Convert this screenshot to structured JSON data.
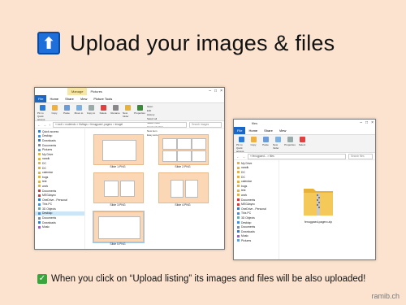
{
  "header": {
    "icon": "up-arrow-icon",
    "title": "Upload your images & files",
    "icon_glyph": "⬆"
  },
  "footer": {
    "text": "When you click on “Upload listing” its images and files will be also uploaded!",
    "check_glyph": "✓"
  },
  "brand": "ramib.ch",
  "left_window": {
    "context_tab": "Manage",
    "title": "Pictures",
    "menu": [
      "File",
      "Home",
      "Share",
      "View",
      "Picture Tools"
    ],
    "ribbon": [
      "Pin to Quick access",
      "Copy",
      "Paste",
      "Move to",
      "Copy to",
      "Delete",
      "Rename",
      "New folder",
      "Properties"
    ],
    "ribbon_small": [
      "Open",
      "Edit",
      "History",
      "Select all",
      "Select none",
      "Invert selection",
      "New item",
      "Easy access"
    ],
    "address": "« nodi > nodeindu > f4vlisgs > fenugpaed ,pagero > imagel",
    "search": "Search images",
    "nav": [
      {
        "label": "Quick access",
        "color": "#2b7bd8"
      },
      {
        "label": "Desktop",
        "color": "#3f8fe6"
      },
      {
        "label": "Downloads",
        "color": "#2b7bd8"
      },
      {
        "label": "Documents",
        "color": "#7a8aa0"
      },
      {
        "label": "Pictures",
        "color": "#5aa0e0"
      },
      {
        "label": "My Drive",
        "color": "#e6b23a"
      },
      {
        "label": "nandk",
        "color": "#e6b23a"
      },
      {
        "label": "DC",
        "color": "#e6b23a"
      },
      {
        "label": "DC",
        "color": "#e6b23a"
      },
      {
        "label": "calendar",
        "color": "#e6b23a"
      },
      {
        "label": "bugs",
        "color": "#e6b23a"
      },
      {
        "label": "test",
        "color": "#e6b23a"
      },
      {
        "label": "work",
        "color": "#e6b23a"
      },
      {
        "label": "Documents",
        "color": "#d33"
      },
      {
        "label": "MEGAsync",
        "color": "#d33"
      },
      {
        "label": "OneDrive - Personal",
        "color": "#2b7bd8"
      },
      {
        "label": "This PC",
        "color": "#3f8fe6"
      },
      {
        "label": "3D Objects",
        "color": "#6aa"
      },
      {
        "label": "Desktop",
        "color": "#3f8fe6"
      },
      {
        "label": "Documents",
        "color": "#7a8aa0"
      },
      {
        "label": "Downloads",
        "color": "#2b7bd8"
      },
      {
        "label": "Music",
        "color": "#a05ad3"
      }
    ],
    "selected_nav_index": 18,
    "thumbs": [
      {
        "caption": "Slide 1.PNG"
      },
      {
        "caption": "Slide 2.PNG"
      },
      {
        "caption": "Slide 3.PNG"
      },
      {
        "caption": "Slide 4.PNG"
      },
      {
        "caption": "Slide 5.PNG"
      }
    ]
  },
  "right_window": {
    "title": "files",
    "menu": [
      "File",
      "Home",
      "Share",
      "View"
    ],
    "ribbon": [
      "Pin to Quick access",
      "Copy",
      "Paste",
      "New folder",
      "Properties",
      "Select"
    ],
    "address": "« fenugpaed... > files",
    "search": "Search files",
    "nav": [
      {
        "label": "My Drive",
        "color": "#e6b23a"
      },
      {
        "label": "nandk",
        "color": "#e6b23a"
      },
      {
        "label": "DC",
        "color": "#e6b23a"
      },
      {
        "label": "DC",
        "color": "#e6b23a"
      },
      {
        "label": "calendar",
        "color": "#e6b23a"
      },
      {
        "label": "bugs",
        "color": "#e6b23a"
      },
      {
        "label": "test",
        "color": "#e6b23a"
      },
      {
        "label": "work",
        "color": "#e6b23a"
      },
      {
        "label": "Documents",
        "color": "#d33"
      },
      {
        "label": "MEGAsync",
        "color": "#d33"
      },
      {
        "label": "OneDrive - Personal",
        "color": "#2b7bd8"
      },
      {
        "label": "This PC",
        "color": "#3f8fe6"
      },
      {
        "label": "3D Objects",
        "color": "#6aa"
      },
      {
        "label": "Desktop",
        "color": "#3f8fe6"
      },
      {
        "label": "Documents",
        "color": "#7a8aa0"
      },
      {
        "label": "Downloads",
        "color": "#2b7bd8"
      },
      {
        "label": "Music",
        "color": "#a05ad3"
      },
      {
        "label": "Pictures",
        "color": "#5aa0e0"
      }
    ],
    "file": {
      "name": "fenugpaed-pagero.zip",
      "icon": "zip-folder-icon"
    }
  }
}
